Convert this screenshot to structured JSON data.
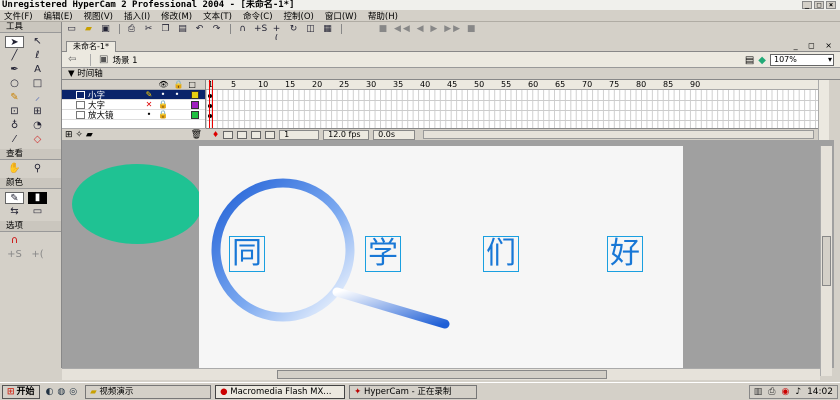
{
  "window": {
    "title": "Unregistered HyperCam 2 Professional 2004 - [未命名-1*]",
    "controls": [
      "_",
      "□",
      "×"
    ]
  },
  "menu": [
    "文件(F)",
    "编辑(E)",
    "视图(V)",
    "插入(I)",
    "修改(M)",
    "文本(T)",
    "命令(C)",
    "控制(O)",
    "窗口(W)",
    "帮助(H)"
  ],
  "toolbar_icons": [
    "new-icon",
    "open-icon",
    "save-icon",
    "print-icon",
    "cut-icon",
    "copy-icon",
    "paste-icon",
    "undo-icon",
    "redo-icon",
    "snap-icon",
    "smooth-icon",
    "straighten-icon",
    "rotate-icon",
    "scale-icon",
    "align-icon"
  ],
  "tools_panel": {
    "header": "工具",
    "view_header": "查看",
    "colors_header": "颜色",
    "options_header": "选项",
    "tools": [
      "arrow-icon",
      "subselect-icon",
      "line-icon",
      "lasso-icon",
      "pen-icon",
      "text-icon",
      "oval-icon",
      "rectangle-icon",
      "pencil-icon",
      "brush-icon",
      "free-transform-icon",
      "fill-transform-icon",
      "ink-bottle-icon",
      "paint-bucket-icon",
      "eyedropper-icon",
      "eraser-icon"
    ]
  },
  "document": {
    "tab": "未命名-1*",
    "scene": "场景 1",
    "zoom": "107%"
  },
  "timeline": {
    "title": "时间轴",
    "layers": [
      {
        "name": "小字",
        "active": true,
        "color": "#e8d010"
      },
      {
        "name": "大字",
        "active": false,
        "color": "#a020c0"
      },
      {
        "name": "放大镜",
        "active": false,
        "color": "#20c040"
      }
    ],
    "ruler_marks": [
      "1",
      "5",
      "10",
      "15",
      "20",
      "25",
      "30",
      "35",
      "40",
      "45",
      "50",
      "55",
      "60",
      "65",
      "70",
      "75",
      "80",
      "85",
      "90"
    ],
    "current_frame": "1",
    "fps": "12.0 fps",
    "time": "0.0s"
  },
  "stage": {
    "chars": [
      "同",
      "学",
      "们",
      "好"
    ],
    "circle_color": "#1fc293",
    "text_color": "#1877d6"
  },
  "taskbar": {
    "start": "开始",
    "tasks": [
      "视频演示",
      "Macromedia Flash MX...",
      "HyperCam - 正在录制"
    ],
    "clock": "14:02"
  }
}
